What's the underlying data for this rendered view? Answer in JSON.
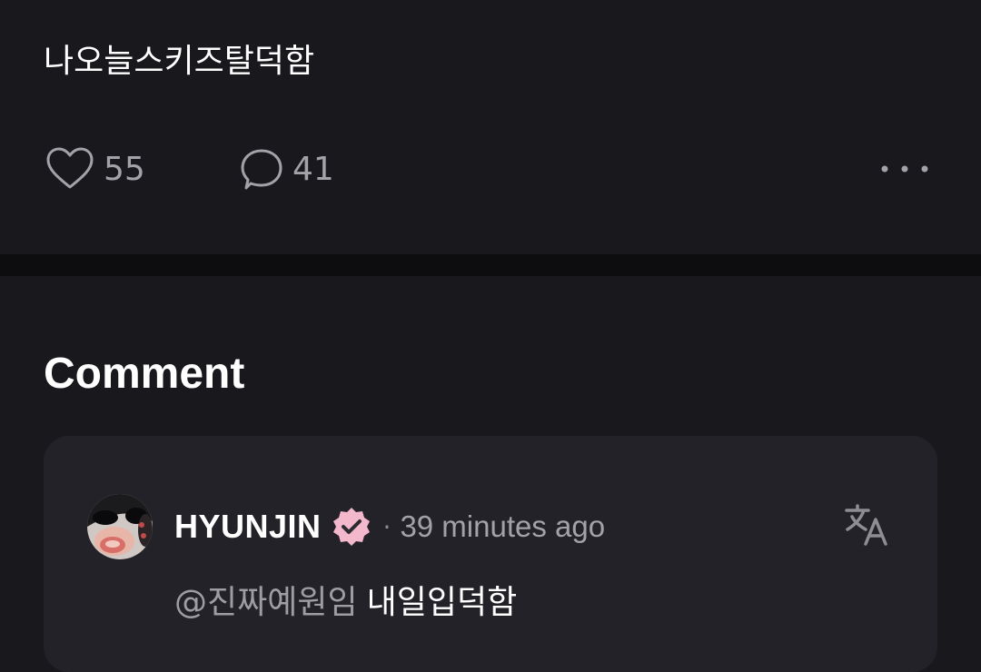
{
  "post": {
    "text": "나오늘스키즈탈덕함",
    "like_count": "55",
    "comment_count": "41"
  },
  "comments_section": {
    "title": "Comment"
  },
  "comment": {
    "author": "HYUNJIN",
    "separator": "·",
    "timestamp": "39 minutes ago",
    "mention": "@진짜예원임",
    "text": "내일입덕함"
  },
  "icons": {
    "like": "heart-outline-icon",
    "comment": "speech-bubble-icon",
    "more": "more-horizontal-icon",
    "verified": "verified-badge-icon",
    "translate": "translate-icon"
  },
  "colors": {
    "background": "#19181d",
    "card": "#232228",
    "divider": "#0d0d10",
    "muted_text": "#a3a2a8",
    "verified_badge": "#f4b8cc"
  }
}
